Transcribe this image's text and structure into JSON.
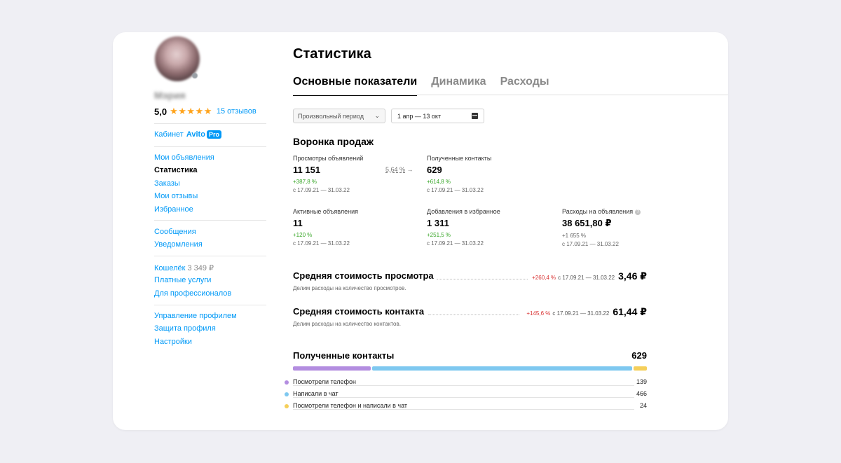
{
  "sidebar": {
    "user_name": "Мэрия",
    "rating": "5,0",
    "stars": "★★★★★",
    "reviews_link": "15 отзывов",
    "cabinet": {
      "label": "Кабинет",
      "brand": "Avito",
      "badge": "Pro"
    },
    "group1": [
      "Мои объявления",
      "Статистика",
      "Заказы",
      "Мои отзывы",
      "Избранное"
    ],
    "active_item": "Статистика",
    "group2": [
      "Сообщения",
      "Уведомления"
    ],
    "wallet": {
      "label": "Кошелёк",
      "amount": "3 349 ₽"
    },
    "group3": [
      "Платные услуги",
      "Для профессионалов"
    ],
    "group4": [
      "Управление профилем",
      "Защита профиля",
      "Настройки"
    ]
  },
  "main": {
    "title": "Статистика",
    "tabs": [
      "Основные показатели",
      "Динамика",
      "Расходы"
    ],
    "active_tab": "Основные показатели",
    "period_select": "Произвольный период",
    "date_range": "1 апр — 13 окт",
    "funnel": {
      "title": "Воронка продаж",
      "conversion": "5,64 %",
      "metrics": [
        {
          "label": "Просмотры объявлений",
          "value": "11 151",
          "change": "+387,8 %",
          "period": "с 17.09.21 — 31.03.22"
        },
        {
          "label": "Полученные контакты",
          "value": "629",
          "change": "+614,8 %",
          "period": "с 17.09.21 — 31.03.22"
        },
        {
          "label": "Активные объявления",
          "value": "11",
          "change": "+120 %",
          "period": "с 17.09.21 — 31.03.22"
        },
        {
          "label": "Добавления в избранное",
          "value": "1 311",
          "change": "+251,5 %",
          "period": "с 17.09.21 — 31.03.22"
        },
        {
          "label": "Расходы на объявления",
          "value": "38 651,80 ₽",
          "change": "+1 655 %",
          "period": "с 17.09.21 — 31.03.22",
          "help_icon": "question-icon"
        }
      ]
    },
    "costs": [
      {
        "title": "Средняя стоимость просмотра",
        "change": "+260,4 %",
        "period": "с 17.09.21 — 31.03.22",
        "value": "3,46 ₽",
        "subtitle": "Делим расходы на количество просмотров."
      },
      {
        "title": "Средняя стоимость контакта",
        "change": "+145,6 %",
        "period": "с 17.09.21 — 31.03.22",
        "value": "61,44 ₽",
        "subtitle": "Делим расходы на количество контактов."
      }
    ],
    "contacts": {
      "title": "Полученные контакты",
      "total": "629",
      "items": [
        {
          "label": "Посмотрели телефон",
          "value": 139,
          "color": "#b38de0"
        },
        {
          "label": "Написали в чат",
          "value": 466,
          "color": "#7ec8f0"
        },
        {
          "label": "Посмотрели телефон и написали в чат",
          "value": 24,
          "color": "#f5cf5a"
        }
      ]
    }
  },
  "colors": {
    "link": "#0099f7",
    "star": "#ffa31a",
    "positive": "#38a628",
    "negative": "#d93333"
  }
}
